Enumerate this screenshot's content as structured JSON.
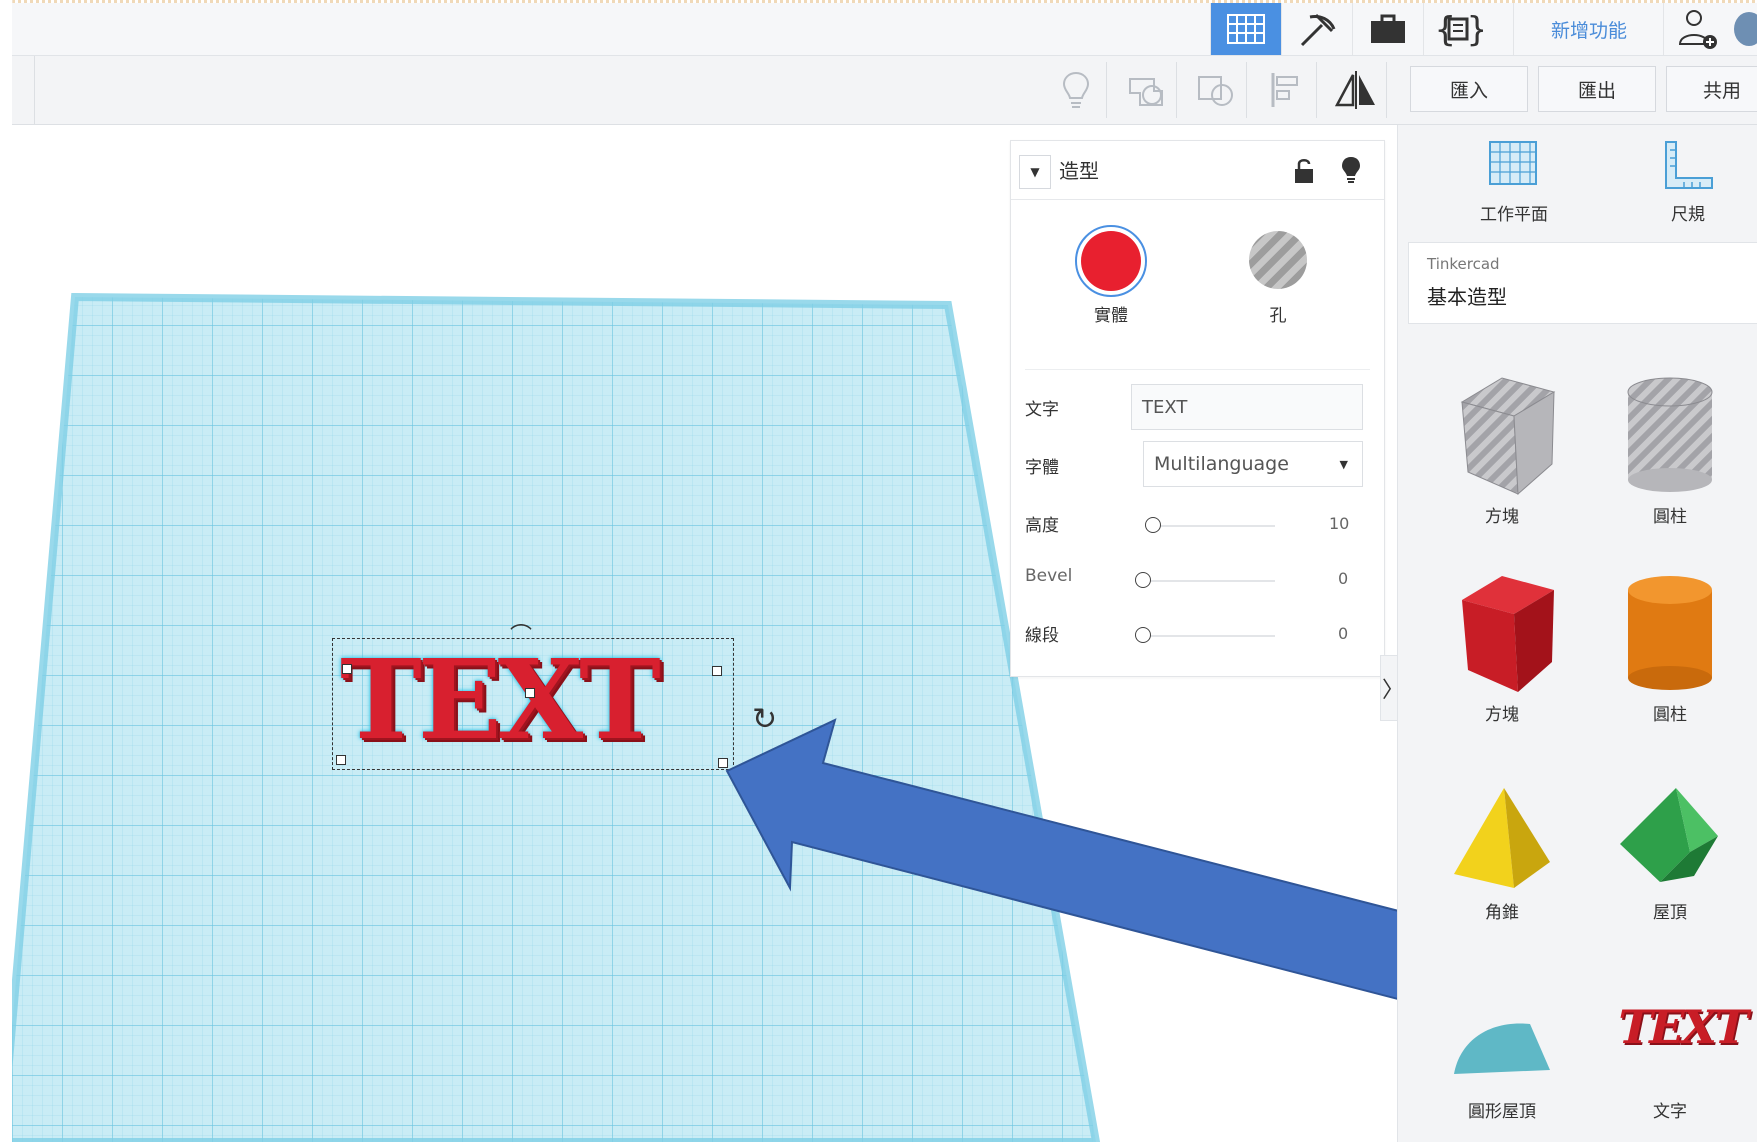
{
  "topbar": {
    "new_features_label": "新增功能",
    "icons": [
      "grid-view-icon",
      "pickaxe-icon",
      "briefcase-icon",
      "code-blocks-icon",
      "add-user-icon",
      "avatar"
    ]
  },
  "toolbar": {
    "import_label": "匯入",
    "export_label": "匯出",
    "share_label": "共用",
    "icons": [
      "lightbulb-icon",
      "group-icon",
      "ungroup-icon",
      "align-icon",
      "mirror-icon"
    ]
  },
  "inspector": {
    "title": "造型",
    "solid_label": "實體",
    "hole_label": "孔",
    "solid_color": "#e8202f",
    "text_label": "文字",
    "text_value": "TEXT",
    "font_label": "字體",
    "font_value": "Multilanguage",
    "height_label": "高度",
    "height_value": "10",
    "bevel_label": "Bevel",
    "bevel_value": "0",
    "segments_label": "線段",
    "segments_value": "0"
  },
  "canvas": {
    "text_shape": "TEXT",
    "accent": "#4472c4"
  },
  "right_panel": {
    "workplane_label": "工作平面",
    "ruler_label": "尺規",
    "library_source": "Tinkercad",
    "library_name": "基本造型",
    "shapes": [
      {
        "label": "方塊",
        "icon": "hole-box-icon"
      },
      {
        "label": "圓柱",
        "icon": "hole-cylinder-icon"
      },
      {
        "label": "方塊",
        "icon": "box-icon"
      },
      {
        "label": "圓柱",
        "icon": "cylinder-icon"
      },
      {
        "label": "角錐",
        "icon": "pyramid-icon"
      },
      {
        "label": "屋頂",
        "icon": "roof-icon"
      },
      {
        "label": "圓形屋頂",
        "icon": "round-roof-icon"
      },
      {
        "label": "文字",
        "icon": "text-shape-icon"
      }
    ]
  }
}
